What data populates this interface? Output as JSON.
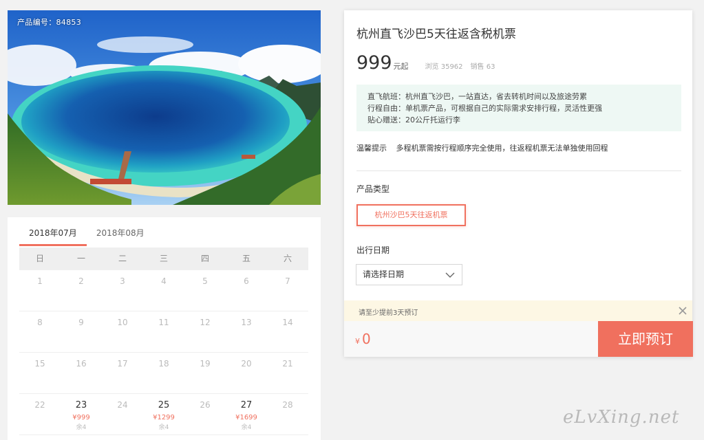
{
  "product": {
    "id_label": "产品编号：84853",
    "title": "杭州直飞沙巴5天往返含税机票",
    "price": "999",
    "price_suffix": "元起",
    "views": "浏览 35962",
    "sales": "销售 63"
  },
  "features": [
    "直飞航班：杭州直飞沙巴，一站直达，省去转机时间以及旅途劳累",
    "行程自由：单机票产品，可根据自己的实际需求安排行程，灵活性更强",
    "贴心赠送：20公斤托运行李"
  ],
  "notice": {
    "label": "温馨提示",
    "text": "多程机票需按行程顺序完全使用，往返程机票无法单独使用回程"
  },
  "product_type": {
    "label": "产品类型",
    "selected": "杭州沙巴5天往返机票"
  },
  "travel_date": {
    "label": "出行日期",
    "placeholder": "请选择日期"
  },
  "tip": "请至少提前3天预订",
  "total": {
    "currency": "¥",
    "amount": "0"
  },
  "book_button": "立即预订",
  "calendar": {
    "tabs": [
      "2018年07月",
      "2018年08月"
    ],
    "active_tab": 0,
    "weekdays": [
      "日",
      "一",
      "二",
      "三",
      "四",
      "五",
      "六"
    ],
    "days": [
      {
        "d": "1"
      },
      {
        "d": "2"
      },
      {
        "d": "3"
      },
      {
        "d": "4"
      },
      {
        "d": "5"
      },
      {
        "d": "6"
      },
      {
        "d": "7"
      },
      {
        "d": "8"
      },
      {
        "d": "9"
      },
      {
        "d": "10"
      },
      {
        "d": "11"
      },
      {
        "d": "12"
      },
      {
        "d": "13"
      },
      {
        "d": "14"
      },
      {
        "d": "15"
      },
      {
        "d": "16"
      },
      {
        "d": "17"
      },
      {
        "d": "18"
      },
      {
        "d": "19"
      },
      {
        "d": "20"
      },
      {
        "d": "21"
      },
      {
        "d": "22"
      },
      {
        "d": "23",
        "price": "¥999",
        "stock": "余4"
      },
      {
        "d": "24"
      },
      {
        "d": "25",
        "price": "¥1299",
        "stock": "余4"
      },
      {
        "d": "26"
      },
      {
        "d": "27",
        "price": "¥1699",
        "stock": "余4"
      },
      {
        "d": "28"
      }
    ]
  },
  "watermark": "eLvXing.net",
  "colors": {
    "accent": "#f0705e",
    "feature_bg": "#eef8f4",
    "tip_bg": "#fdf7e4"
  }
}
